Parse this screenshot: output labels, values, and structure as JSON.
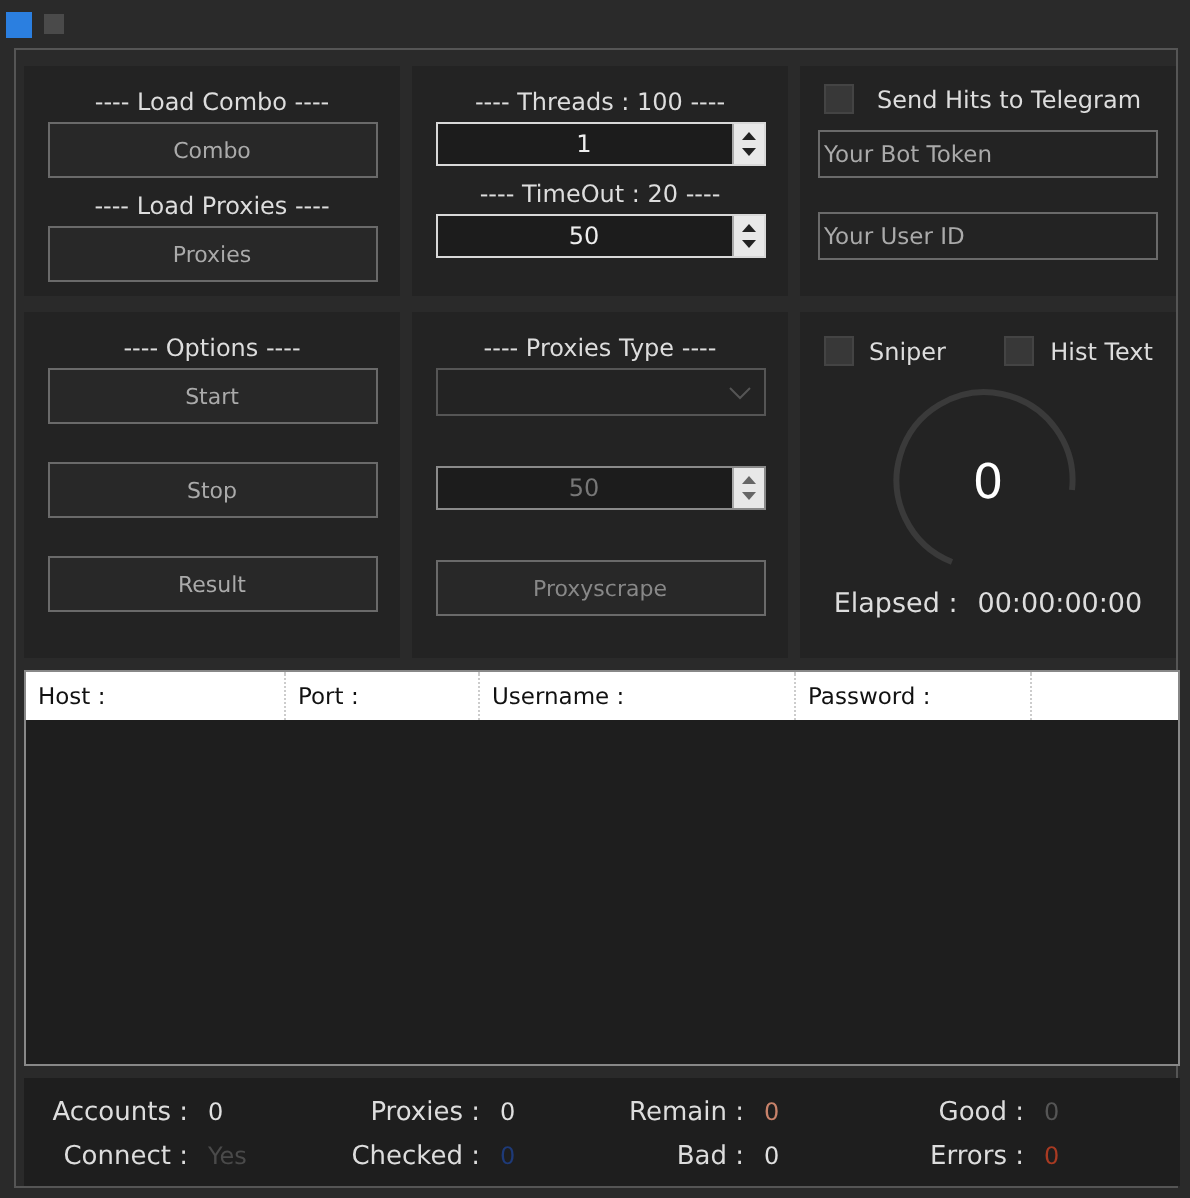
{
  "load": {
    "combo_heading": "---- Load Combo ----",
    "combo_button": "Combo",
    "proxies_heading": "---- Load Proxies ----",
    "proxies_button": "Proxies"
  },
  "threads": {
    "heading": "---- Threads : 100 ----",
    "value": "1",
    "timeout_heading": "---- TimeOut : 20 ----",
    "timeout_value": "50"
  },
  "telegram": {
    "label": "Send Hits to Telegram",
    "checked": false,
    "bot_token_placeholder": "Your Bot Token",
    "user_id_placeholder": "Your User ID"
  },
  "options": {
    "heading": "---- Options ----",
    "buttons": [
      "Start",
      "Stop",
      "Result"
    ]
  },
  "proxies_type": {
    "heading": "---- Proxies Type ----",
    "spinner_value": "50",
    "button": "Proxyscrape",
    "disabled": true
  },
  "counter": {
    "checkboxes": [
      {
        "label": "Sniper",
        "checked": false
      },
      {
        "label": "Hist Text",
        "checked": false
      }
    ],
    "value": "0",
    "elapsed_label": "Elapsed :",
    "elapsed_value": "00:00:00:00"
  },
  "table": {
    "columns": [
      "Host :",
      "Port :",
      "Username :",
      "Password :"
    ]
  },
  "stats": [
    {
      "label": "Accounts :",
      "value": "0",
      "color": "#e0e0e0"
    },
    {
      "label": "Proxies :",
      "value": "0",
      "color": "#e0e0e0"
    },
    {
      "label": "Remain :",
      "value": "0",
      "color": "#c8826a"
    },
    {
      "label": "Good :",
      "value": "0",
      "color": "#555555"
    },
    {
      "label": "Connect :",
      "value": "Yes",
      "color": "#4a4a4a"
    },
    {
      "label": "Checked :",
      "value": "0",
      "color": "#1e3a78"
    },
    {
      "label": "Bad :",
      "value": "0",
      "color": "#e0e0e0"
    },
    {
      "label": "Errors :",
      "value": "0",
      "color": "#a83a22"
    }
  ]
}
